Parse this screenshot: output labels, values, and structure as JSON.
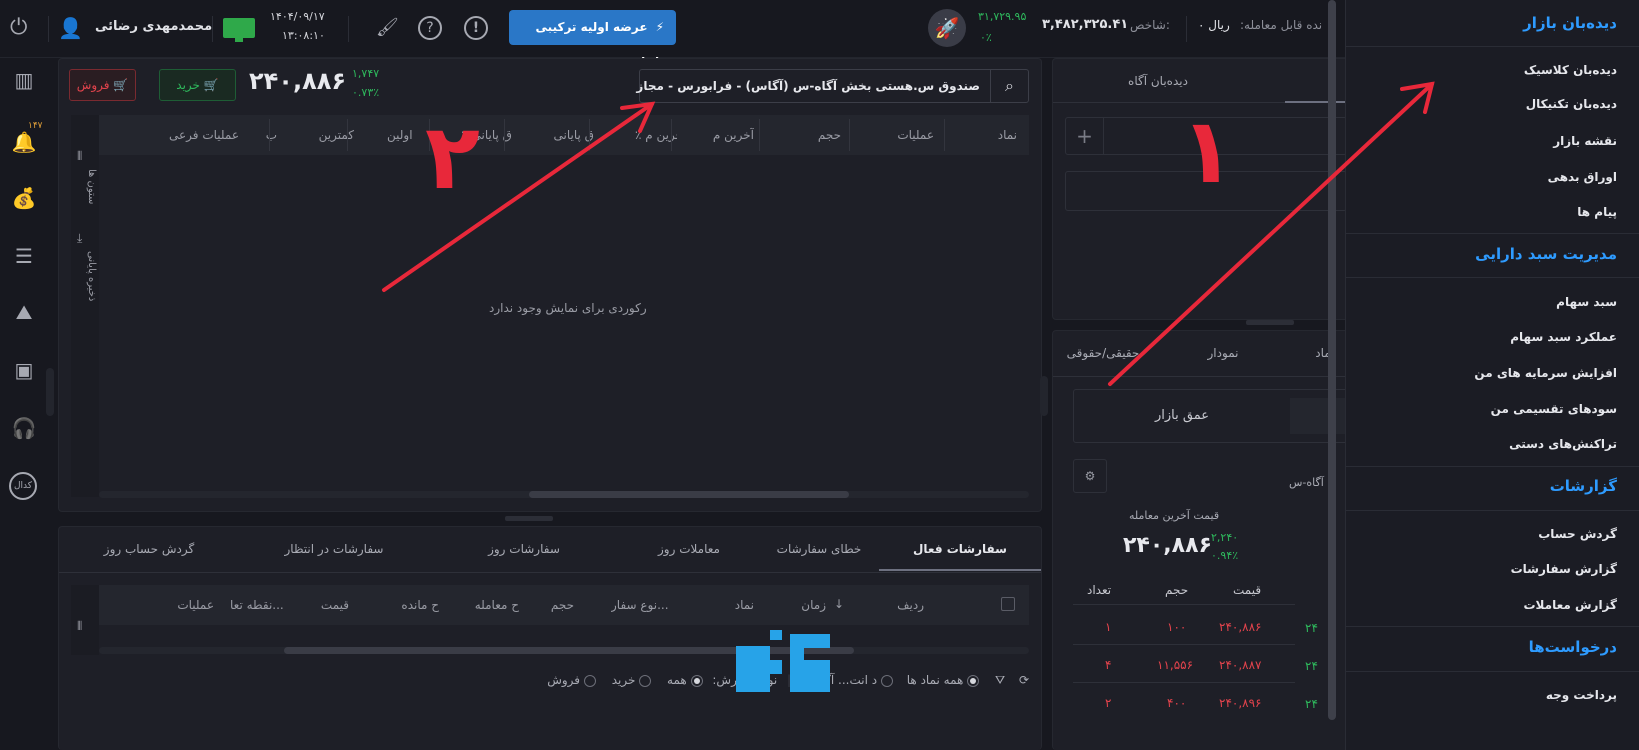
{
  "topbar": {
    "username": "محمدمهدی رضائی",
    "date": "۱۴۰۴/۰۹/۱۷",
    "time": "۱۳:۰۸:۱۰",
    "offering_button": "عرضه اولیه ترکیبی بانیان",
    "index_change": "۳۱,۷۲۹.۹۵",
    "index_change_pct": "۰٪",
    "index_value": "۳,۴۸۲,۳۲۵.۴۱",
    "index_label": "شاخص:",
    "tradable_label": "نده قابل معامله:",
    "tradable_value": "۰ ریال"
  },
  "left_rail": {
    "badge": "۱۴۷",
    "codal": "کدال"
  },
  "symbol_panel": {
    "search_value": "صندوق س.هستی بخش آگاه-س (آگاس) - فرابورس - مجاز",
    "price": "۲۴۰,۸۸۶",
    "change": "۱,۷۴۷",
    "change_pct": "۰.۷۳٪",
    "buy_label": "خرید",
    "sell_label": "فروش",
    "columns": [
      "نماد",
      "عملیات",
      "حجم",
      "آخرین م",
      "٪ آخرین م",
      "ق پایانی",
      "٪ ق پایانی",
      "اولین",
      "کمترین",
      "ب",
      "عملیات فرعی"
    ],
    "empty_text": "رکوردی برای نمایش وجود ندارد",
    "side_columns": "ستون ها",
    "side_save": "ذخیره پایانی"
  },
  "orders_panel": {
    "tabs": [
      "سفارشات فعال",
      "خطای سفارشات",
      "معاملات روز",
      "سفارشات روز",
      "سفارشات در انتظار",
      "گردش حساب روز"
    ],
    "columns": [
      "ردیف",
      "زمان",
      "نماد",
      "نوع سفار...",
      "حجم",
      "ح معامله",
      "ح مانده",
      "قیمت",
      "نقطه تعا...",
      "عملیات"
    ],
    "filter_all_symbols": "همه نماد ها",
    "filter_partial": "د انت... آگاس",
    "order_type_label": "نوع سفارش:",
    "order_all": "همه",
    "order_buy": "خرید",
    "order_sell": "فروش"
  },
  "watch_panel": {
    "tab_agah": "دیده‌بان آگاه",
    "tabs2": [
      "ماد",
      "نمودار",
      "حقیقی/حقوقی"
    ],
    "market_depth": "عمق بازار",
    "symbol_short": "آگاه-س",
    "last_trade_label": "قیمت آخرین معامله",
    "last_trade_price": "۲۴۰,۸۸۶",
    "last_change": "۲,۲۴۰",
    "last_change_pct": "۰.۹۴٪",
    "depth_headers": [
      "قیمت",
      "حجم",
      "تعداد"
    ],
    "depth_rows": [
      {
        "price": "۲۴۰,۸۸۶",
        "volume": "۱۰۰",
        "count": "۱"
      },
      {
        "price": "۲۴۰,۸۸۷",
        "volume": "۱۱,۵۵۶",
        "count": "۴"
      },
      {
        "price": "۲۴۰,۸۹۶",
        "volume": "۴۰۰",
        "count": "۲"
      }
    ],
    "buy_side_peek": [
      "۲۴",
      "۲۴",
      "۲۴"
    ]
  },
  "right_menu": {
    "sections": [
      {
        "title": "دیده‌بان بازار",
        "items": [
          "دیده‌بان کلاسیک",
          "دیده‌بان تکنیکال",
          "نقشه بازار",
          "اوراق بدهی",
          "پیام ها"
        ]
      },
      {
        "title": "مدیریت سبد دارایی",
        "items": [
          "سبد سهام",
          "عملکرد سبد سهام",
          "افزایش سرمایه های من",
          "سودهای تقسیمی من",
          "تراکنش‌های دستی"
        ]
      },
      {
        "title": "گزارشات",
        "items": [
          "گردش حساب",
          "گزارش سفارشات",
          "گزارش معاملات"
        ]
      },
      {
        "title": "درخواست‌ها",
        "items": [
          "پرداخت وجه"
        ]
      }
    ]
  },
  "annotations": {
    "label_one": "۱",
    "label_two": "۲"
  },
  "colors": {
    "accent": "#2e9bff",
    "green": "#2eb85c",
    "red": "#e2434c",
    "annotation": "#e8283a"
  }
}
